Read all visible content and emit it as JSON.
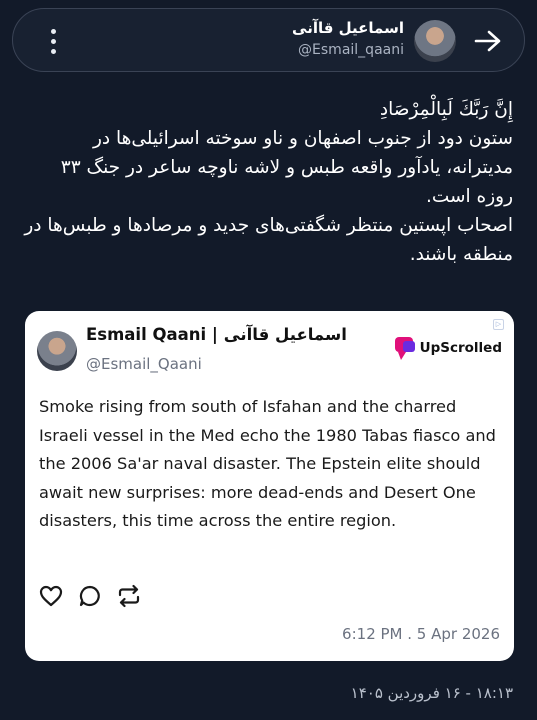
{
  "header": {
    "name": "اسماعیل قاآنی",
    "handle": "@Esmail_qaani",
    "back_icon": "arrow-right-icon",
    "menu_icon": "more-vertical-icon"
  },
  "post": {
    "quran_line": "إِنَّ رَبَّكَ لَبِالْمِرْصَادِ",
    "paragraph1": "ستون دود از جنوب اصفهان و ناو سوخته اسرائیلی‌ها در مدیترانه، یادآور واقعه طبس و لاشه ناوچه ساعر در جنگ ۳۳ روزه است.",
    "paragraph2": "اصحاب اپستین منتظر شگفتی‌های جدید و مرصادها و طبس‌ها در منطقه باشند."
  },
  "card": {
    "name": "Esmail Qaani | اسماعیل قاآنی",
    "handle": "@Esmail_Qaani",
    "logo_text": "UpScrolled",
    "body": "Smoke rising from south of Isfahan and the charred Israeli vessel in the Med echo the 1980 Tabas fiasco and the 2006 Sa'ar naval disaster. The Epstein elite should await new surprises: more dead-ends and Desert One disasters, this time across the entire region.",
    "timestamp": "6:12 PM . 5 Apr 2026",
    "actions": [
      "heart-icon",
      "comment-icon",
      "repost-icon"
    ],
    "accent": "#e0107a"
  },
  "footer": {
    "time": "۱۸:۱۳ - ۱۶ فروردین ۱۴۰۵"
  }
}
